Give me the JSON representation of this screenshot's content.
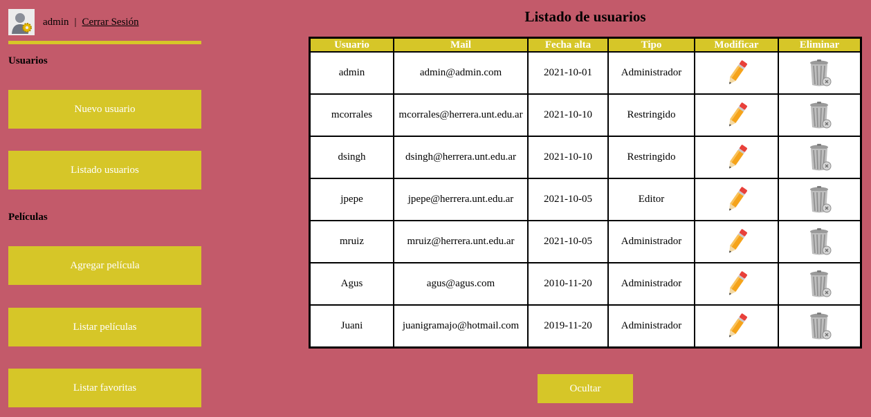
{
  "header": {
    "user_name": "admin",
    "separator": "|",
    "logout_label": "Cerrar Sesión"
  },
  "sidebar": {
    "users_section": "Usuarios",
    "new_user": "Nuevo usuario",
    "list_users": "Listado usuarios",
    "movies_section": "Películas",
    "add_movie": "Agregar película",
    "list_movies": "Listar películas",
    "list_favorites": "Listar favoritas"
  },
  "main": {
    "title": "Listado de usuarios",
    "columns": [
      "Usuario",
      "Mail",
      "Fecha alta",
      "Tipo",
      "Modificar",
      "Eliminar"
    ],
    "rows": [
      {
        "usuario": "admin",
        "mail": "admin@admin.com",
        "fecha": "2021-10-01",
        "tipo": "Administrador"
      },
      {
        "usuario": "mcorrales",
        "mail": "mcorrales@herrera.unt.edu.ar",
        "fecha": "2021-10-10",
        "tipo": "Restringido"
      },
      {
        "usuario": "dsingh",
        "mail": "dsingh@herrera.unt.edu.ar",
        "fecha": "2021-10-10",
        "tipo": "Restringido"
      },
      {
        "usuario": "jpepe",
        "mail": "jpepe@herrera.unt.edu.ar",
        "fecha": "2021-10-05",
        "tipo": "Editor"
      },
      {
        "usuario": "mruiz",
        "mail": "mruiz@herrera.unt.edu.ar",
        "fecha": "2021-10-05",
        "tipo": "Administrador"
      },
      {
        "usuario": "Agus",
        "mail": "agus@agus.com",
        "fecha": "2010-11-20",
        "tipo": "Administrador"
      },
      {
        "usuario": "Juani",
        "mail": "juanigramajo@hotmail.com",
        "fecha": "2019-11-20",
        "tipo": "Administrador"
      }
    ],
    "hide_label": "Ocultar"
  },
  "icons": {
    "avatar": "user-gear-icon",
    "edit": "pencil-icon",
    "delete": "trash-can-icon"
  },
  "colors": {
    "background": "#c35a6a",
    "accent": "#d6c628"
  }
}
